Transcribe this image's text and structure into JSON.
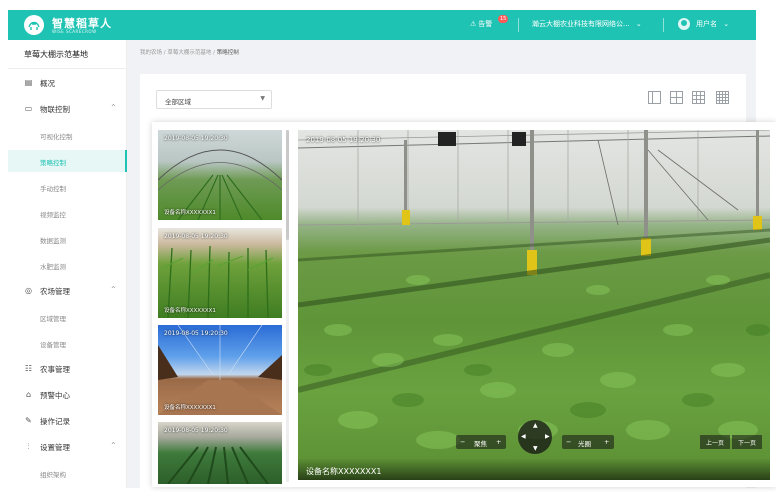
{
  "header": {
    "brand": "智慧稻草人",
    "brand_sub": "WISE SCARECROW",
    "alert_label": "告警",
    "alert_count": "15",
    "company": "瀚云大棚农业科技有限网络公...",
    "user_name": "用户名"
  },
  "sidebar": {
    "base_title": "草莓大棚示范基地",
    "overview": "概况",
    "iot": {
      "label": "物联控制",
      "items": [
        "可视化控制",
        "策略控制",
        "手动控制",
        "视频监控",
        "数据监测",
        "水肥监测"
      ],
      "active": "策略控制"
    },
    "farm": {
      "label": "农场管理",
      "items": [
        "区域管理",
        "设备管理"
      ]
    },
    "farm_affairs": "农事管理",
    "alert_center": "预警中心",
    "op_log": "操作记录",
    "settings": {
      "label": "设置管理",
      "items": [
        "组织架构"
      ]
    }
  },
  "breadcrumb": {
    "part1": "我的农场",
    "sep": " / ",
    "part2": "草莓大棚示范基地",
    "part3": "策略控制"
  },
  "filter": {
    "area_select": "全部区域"
  },
  "thumbnails": [
    {
      "timestamp": "2019-08-05  19:20:30",
      "device": "设备名称XXXXXXX1"
    },
    {
      "timestamp": "2019-08-05  19:20:30",
      "device": "设备名称XXXXXXX1"
    },
    {
      "timestamp": "2019-08-05  19:20:30",
      "device": "设备名称XXXXXXX1"
    },
    {
      "timestamp": "2019-08-05  19:20:30",
      "device": ""
    }
  ],
  "main_view": {
    "timestamp": "2019-08-05  19:20:30",
    "device": "设备名称XXXXXXX1",
    "focus_label": "聚焦",
    "aperture_label": "光圈",
    "prev_label": "上一页",
    "next_label": "下一页"
  }
}
